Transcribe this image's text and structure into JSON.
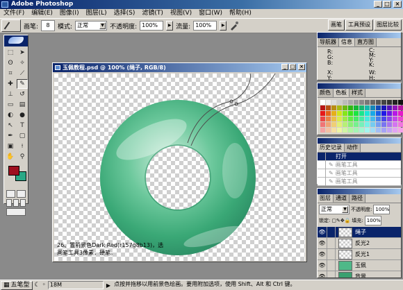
{
  "app": {
    "title": "Adobe Photoshop"
  },
  "menu": [
    "文件(F)",
    "编辑(E)",
    "图像(I)",
    "图层(L)",
    "选择(S)",
    "滤镜(T)",
    "视图(V)",
    "窗口(W)",
    "帮助(H)"
  ],
  "options": {
    "brush_label": "画笔:",
    "brush_size": "8",
    "mode_label": "模式:",
    "mode_value": "正常",
    "opacity_label": "不透明度:",
    "opacity_value": "100%",
    "flow_label": "流量:",
    "flow_value": "100%"
  },
  "palette_well": [
    "画笔",
    "工具预设",
    "图层比较"
  ],
  "document": {
    "title": "玉佩教程.psd @ 100% (绳子, RGB/8)",
    "caption_line1": "26、置前景色Dark Red(r157g8b13)，选",
    "caption_line2": "画笔工具3像素，硬笔。"
  },
  "navigator": {
    "tabs": [
      "导航器",
      "信息",
      "直方图"
    ],
    "labels": [
      "R:",
      "G:",
      "B:",
      "C:",
      "M:",
      "Y:",
      "K:",
      "X:",
      "Y:",
      "W:",
      "H:"
    ]
  },
  "colors_panel": {
    "tabs": [
      "颜色",
      "色板",
      "样式"
    ]
  },
  "history": {
    "tabs": [
      "历史记录",
      "动作"
    ],
    "items": [
      {
        "label": "打开",
        "selected": true
      },
      {
        "label": "画笔工具",
        "selected": false
      },
      {
        "label": "画笔工具",
        "selected": false
      },
      {
        "label": "画笔工具",
        "selected": false
      }
    ]
  },
  "layers": {
    "tabs": [
      "图层",
      "通道",
      "路径"
    ],
    "blend_mode": "正常",
    "opacity_label": "不透明度:",
    "opacity_value": "100%",
    "lock_label": "锁定:",
    "fill_label": "填充:",
    "fill_value": "100%",
    "items": [
      {
        "name": "绳子",
        "selected": true
      },
      {
        "name": "反光2",
        "selected": false
      },
      {
        "name": "反光1",
        "selected": false
      },
      {
        "name": "玉佩",
        "selected": false
      },
      {
        "name": "背景",
        "selected": false
      }
    ]
  },
  "status": {
    "start_label": "五笔型",
    "doc_size": "18M",
    "hint": "点按并拖移以用前景色绘画。要用附加选项，使用 Shift、Alt 和 Ctrl 键。"
  },
  "colors": {
    "foreground": "#9d080d",
    "background": "#2aa886",
    "jade": "#3fb07c",
    "title_blue": "#0a246a"
  }
}
